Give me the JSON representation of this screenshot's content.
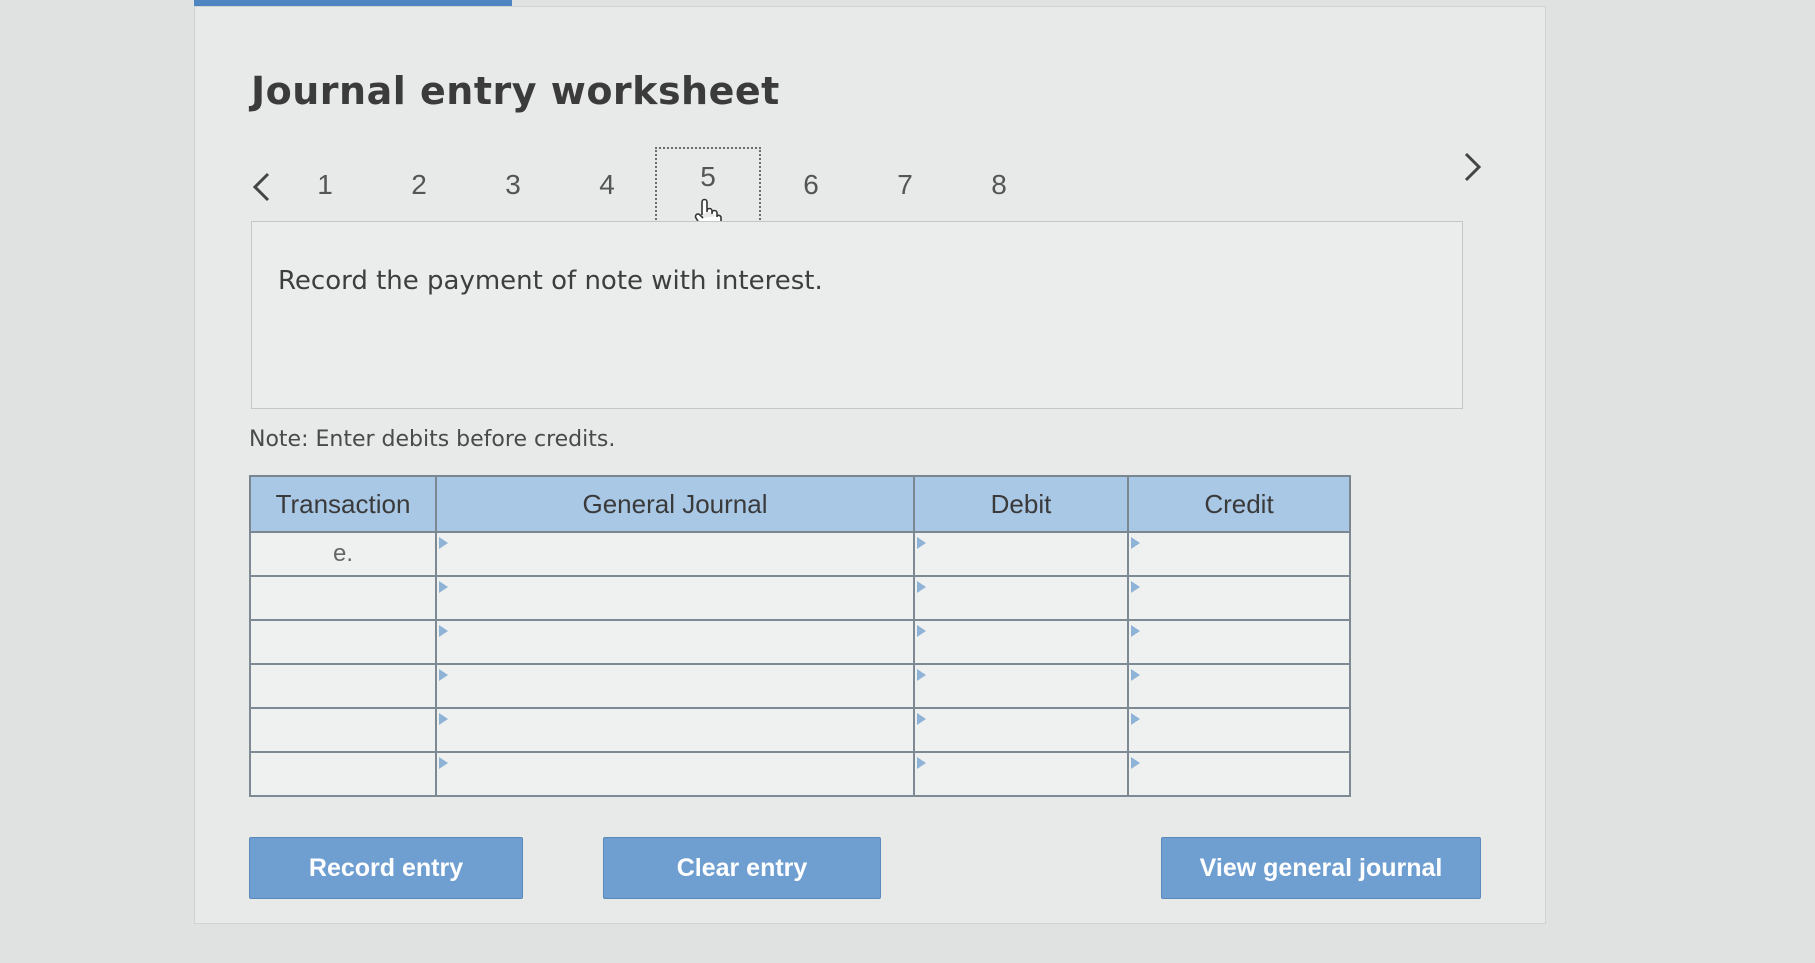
{
  "header": {
    "title": "Journal entry worksheet"
  },
  "stepper": {
    "steps": [
      "1",
      "2",
      "3",
      "4",
      "5",
      "6",
      "7",
      "8"
    ],
    "active_step": "5"
  },
  "instruction": {
    "text": "Record the payment of note with interest."
  },
  "note": {
    "text": "Note: Enter debits before credits."
  },
  "table": {
    "columns": [
      "Transaction",
      "General Journal",
      "Debit",
      "Credit"
    ],
    "rows": [
      {
        "transaction": "e.",
        "account": "",
        "debit": "",
        "credit": ""
      },
      {
        "transaction": "",
        "account": "",
        "debit": "",
        "credit": ""
      },
      {
        "transaction": "",
        "account": "",
        "debit": "",
        "credit": ""
      },
      {
        "transaction": "",
        "account": "",
        "debit": "",
        "credit": ""
      },
      {
        "transaction": "",
        "account": "",
        "debit": "",
        "credit": ""
      },
      {
        "transaction": "",
        "account": "",
        "debit": "",
        "credit": ""
      }
    ]
  },
  "buttons": {
    "record_entry": "Record entry",
    "clear_entry": "Clear entry",
    "view_general_journal": "View general journal"
  },
  "colors": {
    "header_fill": "#a9c8e6",
    "button_fill": "#6f9fd1",
    "accent_tab": "#4f86c1"
  }
}
